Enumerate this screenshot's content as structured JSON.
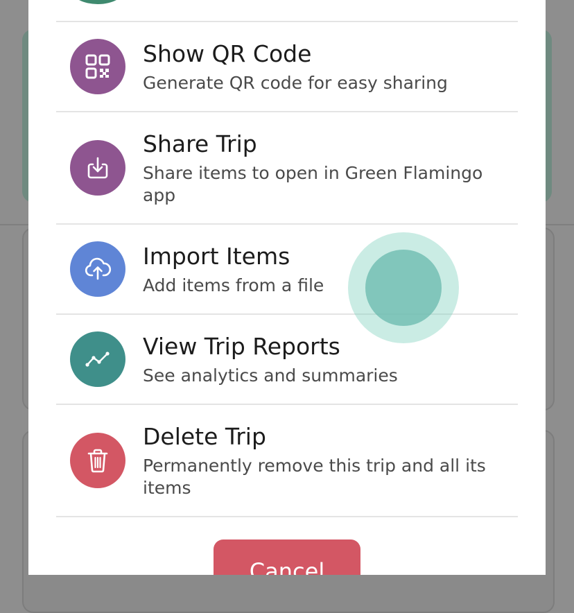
{
  "sheet": {
    "items": [
      {
        "title": "Show QR Code",
        "subtitle": "Generate QR code for easy sharing",
        "icon": "qr-code-icon",
        "color": "#8e5590"
      },
      {
        "title": "Share Trip",
        "subtitle": "Share items to open in Green Flamingo app",
        "icon": "download-box-icon",
        "color": "#8e5590"
      },
      {
        "title": "Import Items",
        "subtitle": "Add items from a file",
        "icon": "cloud-upload-icon",
        "color": "#5f85d6"
      },
      {
        "title": "View Trip Reports",
        "subtitle": "See analytics and summaries",
        "icon": "line-chart-icon",
        "color": "#3f8f8a"
      },
      {
        "title": "Delete Trip",
        "subtitle": "Permanently remove this trip and all its items",
        "icon": "trash-icon",
        "color": "#d35764"
      }
    ],
    "cancel_label": "Cancel"
  }
}
